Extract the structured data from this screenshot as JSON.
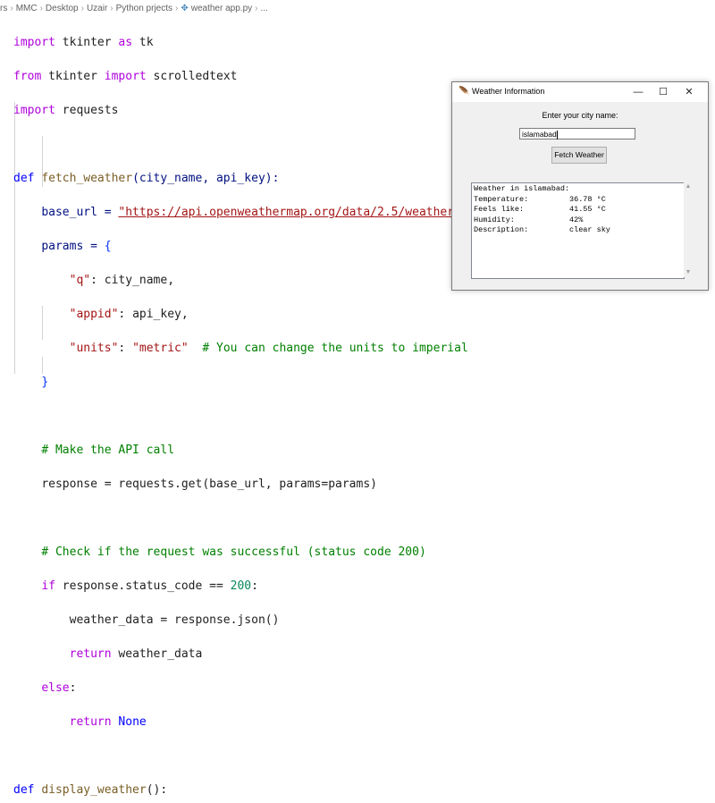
{
  "breadcrumb": {
    "items": [
      "rs",
      "MMC",
      "Desktop",
      "Uzair",
      "Python prjects"
    ],
    "file": "weather app.py",
    "tail": "..."
  },
  "code": {
    "l1_kw": "import",
    "l1_rest": " tkinter ",
    "l1_as": "as",
    "l1_tk": " tk",
    "l2_kw": "from",
    "l2_mod": " tkinter ",
    "l2_imp": "import",
    "l2_rest": " scrolledtext",
    "l3_kw": "import",
    "l3_rest": " requests",
    "def1_kw": "def",
    "def1_name": "fetch_weather",
    "def1_args": "(city_name, api_key):",
    "base_url_lhs": "base_url = ",
    "base_url_val": "\"https://api.openweathermap.org/data/2.5/weather\"",
    "params_lhs": "params = ",
    "params_open": "{",
    "q_key": "\"q\"",
    "q_val": ": city_name,",
    "appid_key": "\"appid\"",
    "appid_val": ": api_key,",
    "units_key": "\"units\"",
    "units_sep": ": ",
    "units_val": "\"metric\"",
    "units_comment": "  # You can change the units to imperial",
    "params_close": "}",
    "comment_api": "# Make the API call",
    "resp_line": "response = requests.get(base_url, params=params)",
    "comment_check": "# Check if the request was successful (status code 200)",
    "if_kw": "if",
    "if_cond": " response.status_code == ",
    "if_num": "200",
    "if_colon": ":",
    "wd_line": "weather_data = response.json()",
    "ret1_kw": "return",
    "ret1_rest": " weather_data",
    "else_kw": "else",
    "else_colon": ":",
    "ret2_kw": "return",
    "ret2_rest": " None",
    "def2_kw": "def",
    "def2_name": "display_weather",
    "def2_args": "():"
  },
  "window": {
    "title": "Weather Information",
    "minimize": "—",
    "maximize": "☐",
    "close": "✕",
    "prompt": "Enter your city name:",
    "city_value": "islamabad",
    "fetch_label": "Fetch Weather",
    "output_header": "Weather in islamabad:",
    "rows": [
      {
        "label": "Temperature:",
        "value": "36.78 °C"
      },
      {
        "label": "Feels like:",
        "value": "41.55 °C"
      },
      {
        "label": "Humidity:",
        "value": "42%"
      },
      {
        "label": "Description:",
        "value": "clear sky"
      }
    ]
  },
  "colors": {
    "keyword": "#af00db",
    "keyword_blue": "#0000ff",
    "string": "#a31515",
    "comment": "#008000",
    "function": "#795e26"
  }
}
